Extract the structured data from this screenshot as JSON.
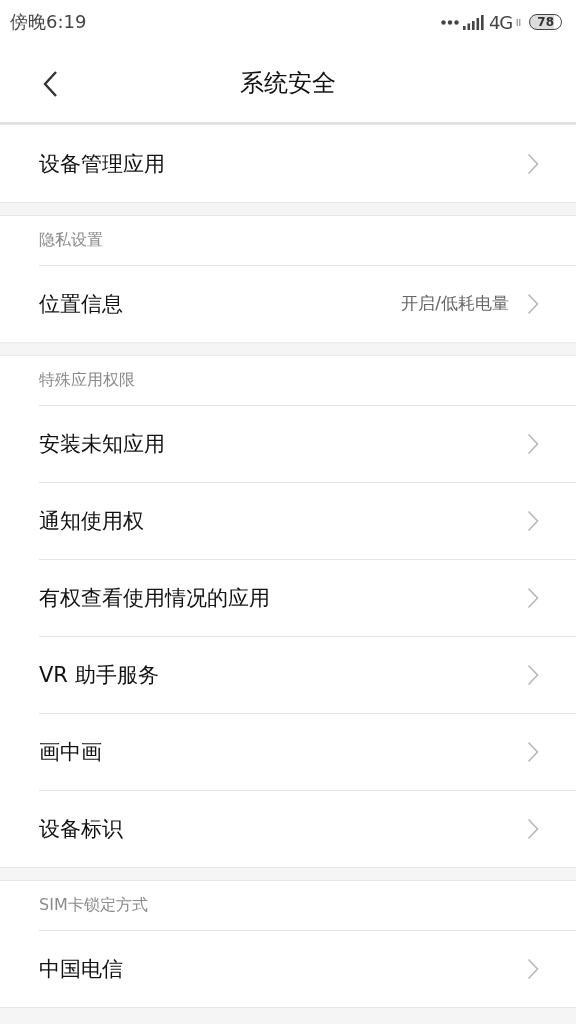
{
  "status_bar": {
    "time": "傍晚6:19",
    "network": "4G",
    "battery": "78"
  },
  "header": {
    "title": "系统安全"
  },
  "sections": [
    {
      "items": [
        {
          "label": "设备管理应用"
        }
      ]
    },
    {
      "title": "隐私设置",
      "items": [
        {
          "label": "位置信息",
          "value": "开启/低耗电量"
        }
      ]
    },
    {
      "title": "特殊应用权限",
      "items": [
        {
          "label": "安装未知应用"
        },
        {
          "label": "通知使用权"
        },
        {
          "label": "有权查看使用情况的应用"
        },
        {
          "label": "VR 助手服务"
        },
        {
          "label": "画中画"
        },
        {
          "label": "设备标识"
        }
      ]
    },
    {
      "title": "SIM卡锁定方式",
      "items": [
        {
          "label": "中国电信"
        }
      ]
    }
  ]
}
